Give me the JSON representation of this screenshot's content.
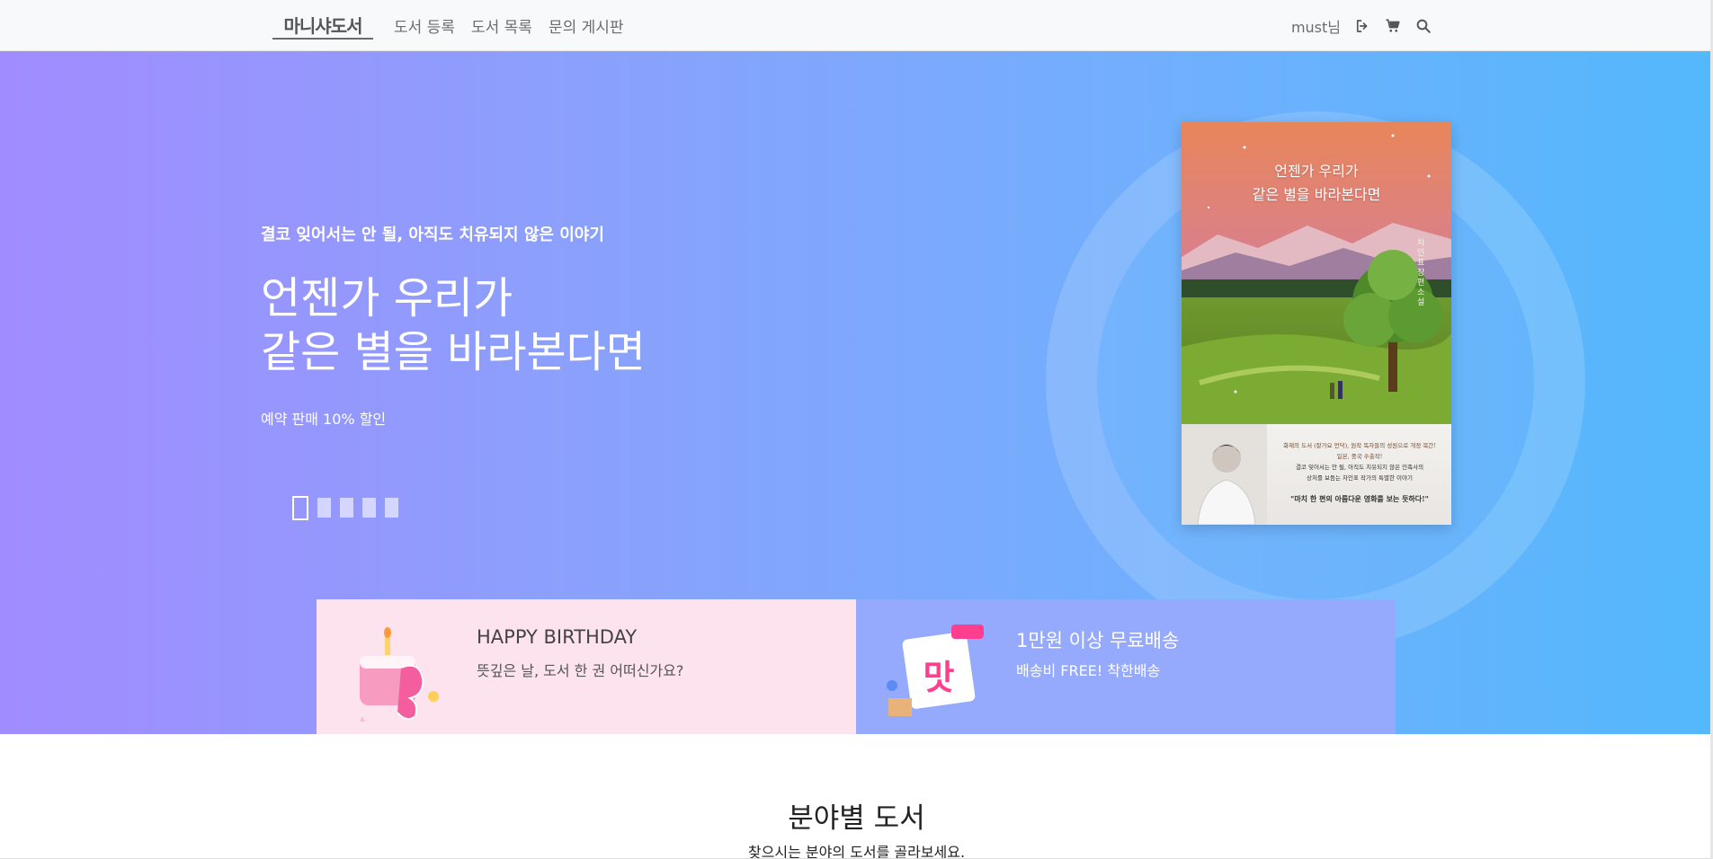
{
  "nav": {
    "logo": "마니샤도서",
    "links": [
      "도서 등록",
      "도서 목록",
      "문의 게시판"
    ],
    "user": "must님",
    "icons": [
      "logout-icon",
      "cart-icon",
      "search-icon"
    ]
  },
  "hero": {
    "subtitle": "결코 잊어서는 안 될, 아직도 치유되지 않은 이야기",
    "title_line1": "언젠가 우리가",
    "title_line2": "같은 별을 바라본다면",
    "description": "예약 판매 10% 할인",
    "carousel": {
      "count": 5,
      "active_index": 0
    },
    "book": {
      "title_line1": "언젠가 우리가",
      "title_line2": "같은 별을 바라본다면",
      "author": "차인표 장편소설",
      "blurb_line1": "화제의 도서 (잘가요 언덕), 원작 독자들의 성원으로 개정 복간!",
      "blurb_line2": "일본, 중국 수출작!",
      "blurb_line3": "결코 잊어서는 안 될, 아직도 치유되지 않은 민족사의",
      "blurb_line4": "상처를 보듬는 차인표 작가의 특별한 이야기",
      "quote": "\"마치 한 편의 아름다운 영화를 보는 듯하다!\""
    }
  },
  "promos": [
    {
      "title": "HAPPY BIRTHDAY",
      "text": "뜻깊은 날, 도서 한 권 어떠신가요?",
      "icon": "birthday-cake-icon"
    },
    {
      "title": "1만원 이상 무료배송",
      "text": "배송비 FREE! 착한배송",
      "icon": "free-delivery-icon"
    }
  ],
  "category": {
    "title": "분야별 도서",
    "subtitle": "찾으시는 분야의 도서를 골라보세요."
  },
  "colors": {
    "hero_start": "#a18cff",
    "hero_end": "#54b8fc",
    "promo_pink": "#fde3ee",
    "promo_blue": "#96aafd"
  }
}
